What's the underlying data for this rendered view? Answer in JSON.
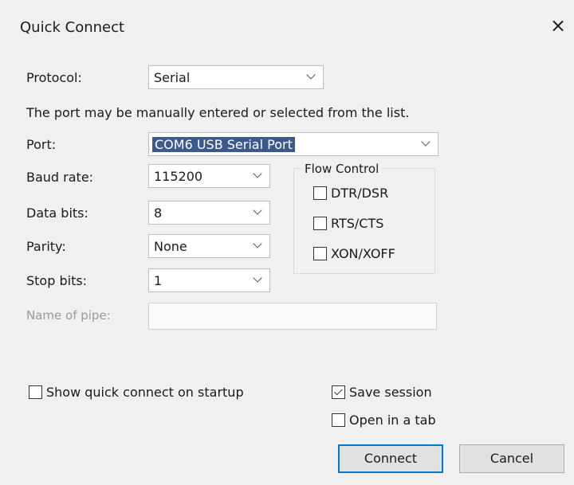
{
  "dialog": {
    "title": "Quick Connect",
    "close_icon": "×"
  },
  "protocol": {
    "label": "Protocol:",
    "value": "Serial"
  },
  "instruction": "The port may be manually entered or selected from the list.",
  "port": {
    "label": "Port:",
    "value": "COM6 USB Serial Port"
  },
  "baud_rate": {
    "label": "Baud rate:",
    "value": "115200"
  },
  "data_bits": {
    "label": "Data bits:",
    "value": "8"
  },
  "parity": {
    "label": "Parity:",
    "value": "None"
  },
  "stop_bits": {
    "label": "Stop bits:",
    "value": "1"
  },
  "pipe": {
    "label": "Name of pipe:",
    "value": ""
  },
  "flow_control": {
    "title": "Flow Control",
    "options": [
      {
        "label": "DTR/DSR",
        "checked": false
      },
      {
        "label": "RTS/CTS",
        "checked": false
      },
      {
        "label": "XON/XOFF",
        "checked": false
      }
    ]
  },
  "options": {
    "show_on_startup": {
      "label": "Show quick connect on startup",
      "checked": false
    },
    "save_session": {
      "label": "Save session",
      "checked": true
    },
    "open_in_tab": {
      "label": "Open in a tab",
      "checked": false
    }
  },
  "buttons": {
    "connect": "Connect",
    "cancel": "Cancel"
  },
  "colors": {
    "selection_highlight": "#3c5a8a",
    "default_button_border": "#0078d7"
  }
}
